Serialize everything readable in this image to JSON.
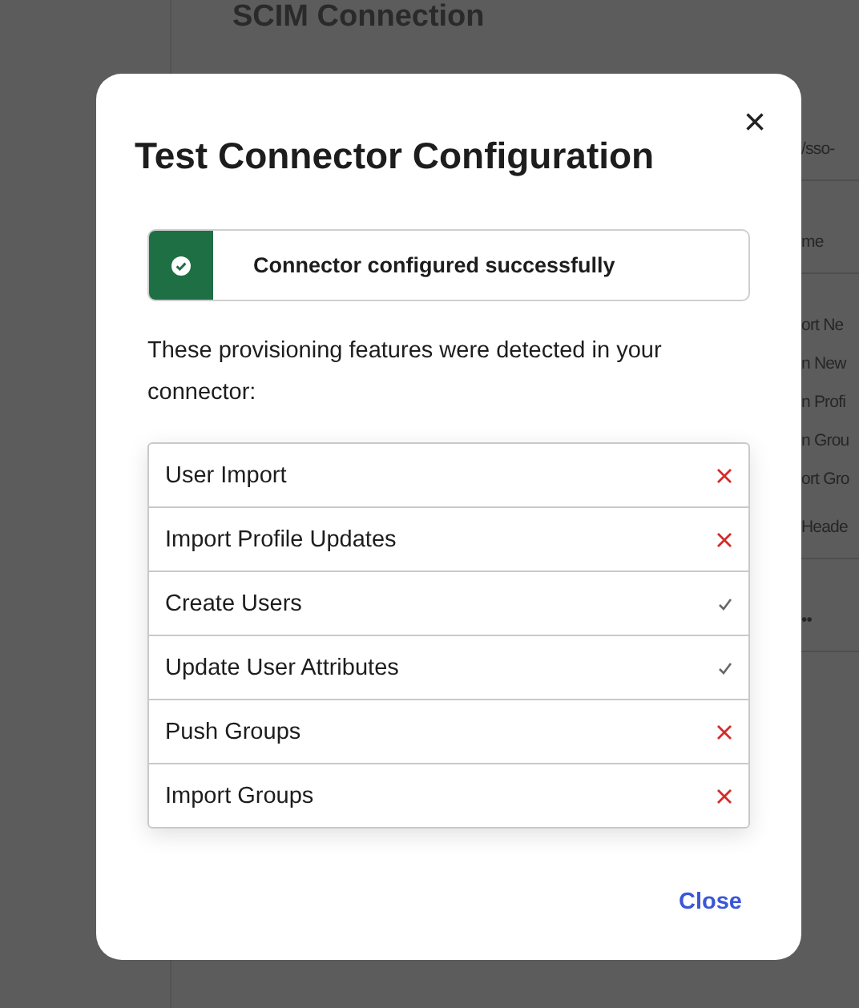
{
  "background": {
    "heading": "SCIM Connection",
    "fragments": [
      {
        "text": "/sso-",
        "kind": "field"
      },
      {
        "text": "me",
        "kind": "field"
      },
      {
        "text": "ort Ne",
        "kind": "line"
      },
      {
        "text": "n New",
        "kind": "line"
      },
      {
        "text": "n Profi",
        "kind": "line"
      },
      {
        "text": "n Grou",
        "kind": "line"
      },
      {
        "text": "ort Gro",
        "kind": "line"
      },
      {
        "text": "Heade",
        "kind": "field"
      },
      {
        "text": "••",
        "kind": "field"
      }
    ]
  },
  "dialog": {
    "title": "Test Connector Configuration",
    "close_icon": "×",
    "banner": {
      "message": "Connector configured successfully"
    },
    "intro": "These provisioning features were detected in your connector:",
    "features": [
      {
        "label": "User Import",
        "supported": false
      },
      {
        "label": "Import Profile Updates",
        "supported": false
      },
      {
        "label": "Create Users",
        "supported": true
      },
      {
        "label": "Update User Attributes",
        "supported": true
      },
      {
        "label": "Push Groups",
        "supported": false
      },
      {
        "label": "Import Groups",
        "supported": false
      }
    ],
    "footer_button": "Close"
  }
}
